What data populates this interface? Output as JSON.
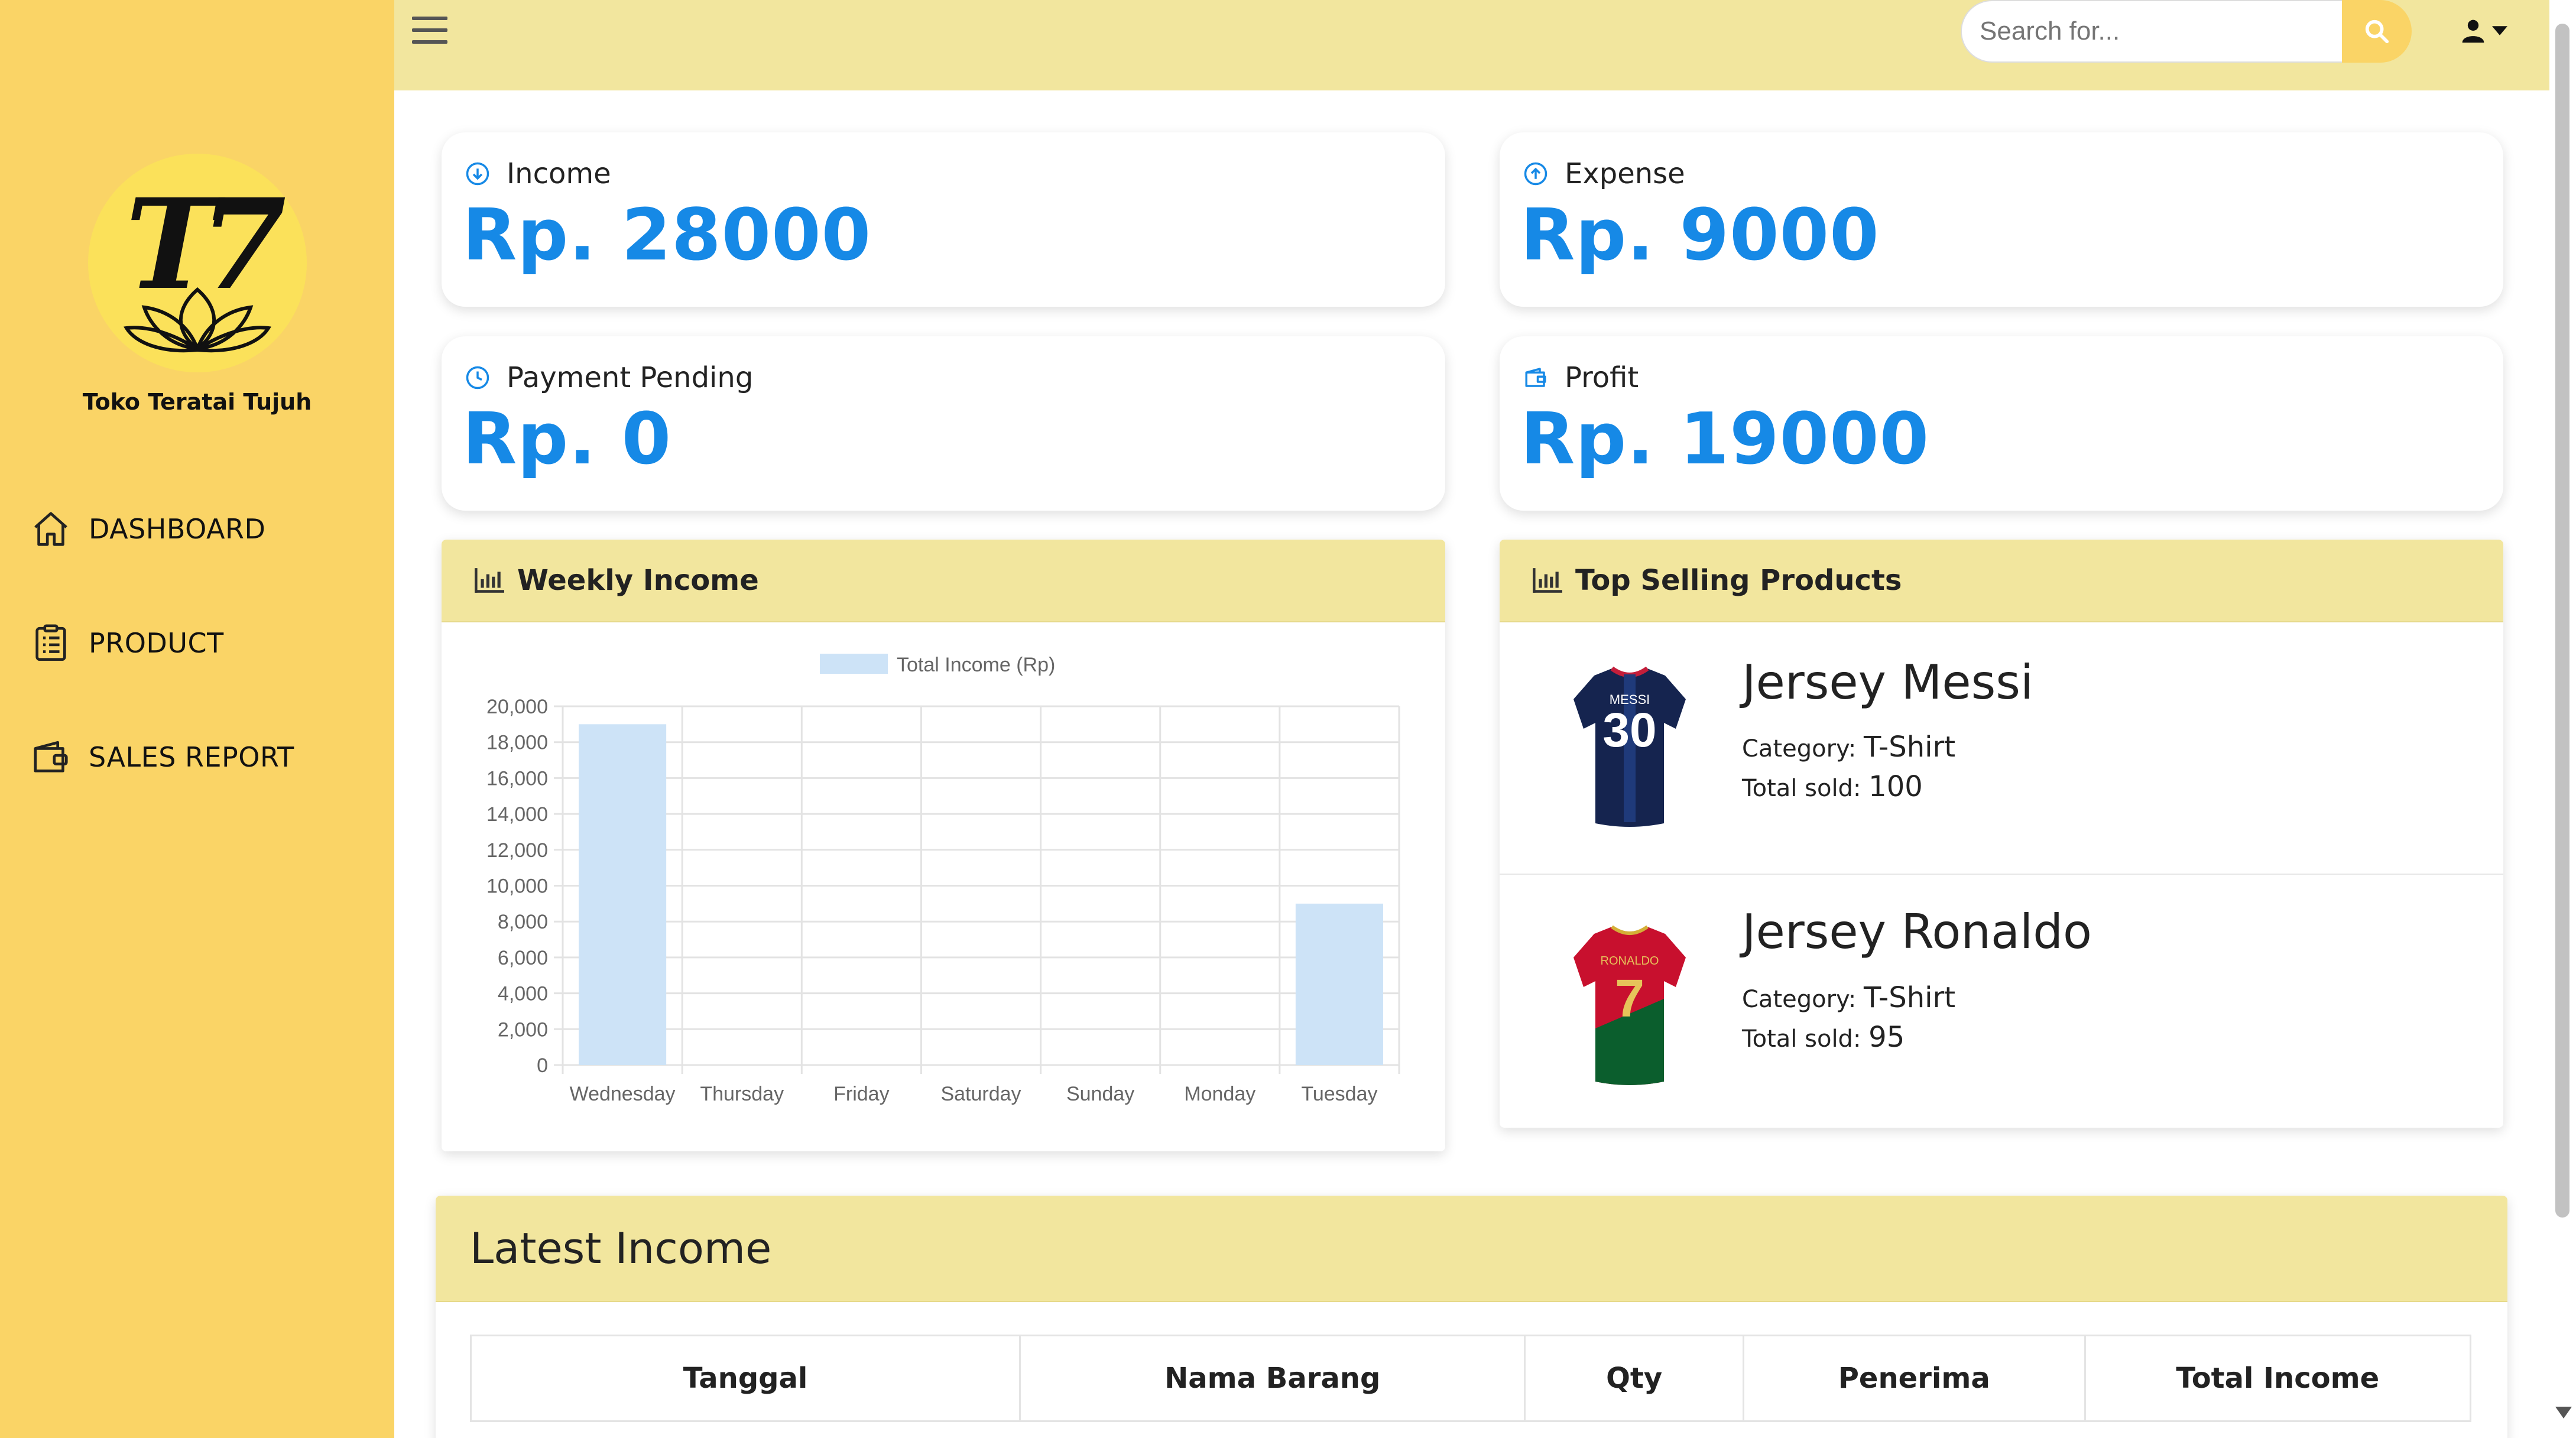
{
  "brand": {
    "name": "Toko Teratai Tujuh",
    "logo_text": "T7"
  },
  "sidebar": {
    "items": [
      {
        "label": "DASHBOARD",
        "icon": "home-icon"
      },
      {
        "label": "PRODUCT",
        "icon": "clipboard-icon"
      },
      {
        "label": "SALES REPORT",
        "icon": "wallet-icon"
      }
    ]
  },
  "topbar": {
    "search_placeholder": "Search for..."
  },
  "stats": {
    "income": {
      "label": "Income",
      "value": "Rp. 28000"
    },
    "expense": {
      "label": "Expense",
      "value": "Rp. 9000"
    },
    "pending": {
      "label": "Payment Pending",
      "value": "Rp. 0"
    },
    "profit": {
      "label": "Profit",
      "value": "Rp. 19000"
    }
  },
  "weekly_income": {
    "title": "Weekly Income"
  },
  "chart_data": {
    "type": "bar",
    "categories": [
      "Wednesday",
      "Thursday",
      "Friday",
      "Saturday",
      "Sunday",
      "Monday",
      "Tuesday"
    ],
    "series": [
      {
        "name": "Total Income (Rp)",
        "values": [
          19000,
          0,
          0,
          0,
          0,
          0,
          9000
        ]
      }
    ],
    "ylim": [
      0,
      20000
    ],
    "yticks": [
      "20,000",
      "18,000",
      "16,000",
      "14,000",
      "12,000",
      "10,000",
      "8,000",
      "6,000",
      "4,000",
      "2,000",
      "0"
    ],
    "legend": "top",
    "grid": true,
    "bar_color": "#cde3f7"
  },
  "top_selling": {
    "title": "Top Selling Products",
    "category_label": "Category:",
    "sold_label": "Total sold:",
    "products": [
      {
        "name": "Jersey Messi",
        "category": "T-Shirt",
        "sold": "100",
        "jersey_name": "MESSI",
        "jersey_number": "30"
      },
      {
        "name": "Jersey Ronaldo",
        "category": "T-Shirt",
        "sold": "95",
        "jersey_name": "RONALDO",
        "jersey_number": "7"
      }
    ]
  },
  "latest_income": {
    "title": "Latest Income",
    "columns": [
      "Tanggal",
      "Nama Barang",
      "Qty",
      "Penerima",
      "Total Income"
    ]
  },
  "colors": {
    "sidebar": "#fad466",
    "topbar": "#f2e69e",
    "accent_blue": "#1689e6"
  }
}
